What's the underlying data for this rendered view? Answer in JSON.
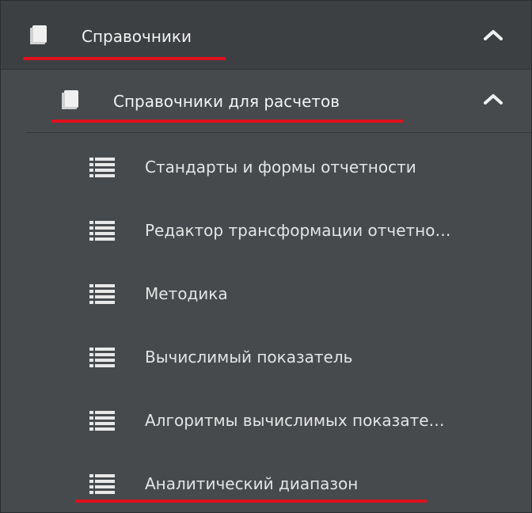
{
  "menu": {
    "section": {
      "label": "Справочники",
      "icon": "book-icon",
      "expanded": true
    },
    "subsection": {
      "label": "Справочники для расчетов",
      "icon": "book-icon",
      "expanded": true
    },
    "items": [
      {
        "label": "Стандарты и формы отчетности",
        "icon": "list-icon"
      },
      {
        "label": "Редактор трансформации отчетно…",
        "icon": "list-icon"
      },
      {
        "label": "Методика",
        "icon": "list-icon"
      },
      {
        "label": "Вычислимый показатель",
        "icon": "list-icon"
      },
      {
        "label": "Алгоритмы вычислимых показате…",
        "icon": "list-icon"
      },
      {
        "label": "Аналитический диапазон",
        "icon": "list-icon"
      }
    ]
  },
  "colors": {
    "background": "#464a4d",
    "header_background": "#3d4043",
    "highlight_underline": "#e0101e",
    "text": "#f2f2f2"
  }
}
